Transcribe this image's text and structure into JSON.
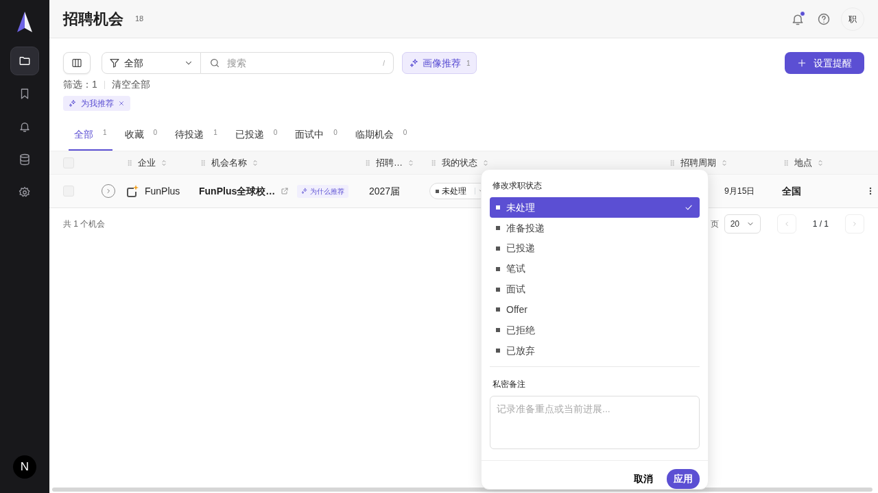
{
  "sidebar": {
    "items": [
      {
        "kind": "folder",
        "selected": true
      },
      {
        "kind": "bookmark",
        "selected": false
      },
      {
        "kind": "bell",
        "selected": false
      },
      {
        "kind": "database",
        "selected": false
      },
      {
        "kind": "gear",
        "selected": false
      }
    ],
    "user_avatar": "N"
  },
  "header": {
    "title": "招聘机会",
    "count": "18",
    "notification_unread": true,
    "avatar": "职"
  },
  "toolbar": {
    "filter": {
      "value": "全部"
    },
    "search": {
      "placeholder": "搜索",
      "shortcut": "/"
    },
    "profile_button": {
      "label": "画像推荐",
      "count": "1"
    },
    "primary_button": {
      "label": "设置提醒"
    }
  },
  "filter_summary": {
    "count_label": "筛选：1",
    "clear": "清空全部"
  },
  "chips": [
    {
      "label": "为我推荐"
    }
  ],
  "tabs": [
    {
      "label": "全部",
      "count": "1",
      "selected": true
    },
    {
      "label": "收藏",
      "count": "0",
      "selected": false
    },
    {
      "label": "待投递",
      "count": "1",
      "selected": false
    },
    {
      "label": "已投递",
      "count": "0",
      "selected": false
    },
    {
      "label": "面试中",
      "count": "0",
      "selected": false
    },
    {
      "label": "临期机会",
      "count": "0",
      "selected": false
    }
  ],
  "table": {
    "all_selected": false,
    "columns": [
      {
        "kind": "label",
        "label": "企业"
      },
      {
        "kind": "label",
        "label": "机会名称"
      },
      {
        "kind": "label",
        "label": "招聘…"
      },
      {
        "kind": "label",
        "label": "我的状态"
      },
      {
        "kind": "covered"
      },
      {
        "kind": "covered"
      },
      {
        "kind": "label",
        "label": "招聘周期"
      },
      {
        "kind": "label",
        "label": "地点"
      }
    ],
    "rows": [
      {
        "selected": false,
        "company": "FunPlus",
        "name": "FunPlus全球校…",
        "tag": "为什么推荐",
        "batch": "2027届",
        "status": "未处理",
        "cycle": "9月15日",
        "location": "全国"
      }
    ]
  },
  "footer": {
    "total": "共 1 个机会",
    "page_size_label": "页",
    "page_size": "20",
    "page": "1 / 1"
  },
  "status_popup": {
    "title": "修改求职状态",
    "options": [
      {
        "label": "未处理",
        "selected": true
      },
      {
        "label": "准备投递",
        "selected": false
      },
      {
        "label": "已投递",
        "selected": false
      },
      {
        "label": "笔试",
        "selected": false
      },
      {
        "label": "面试",
        "selected": false
      },
      {
        "label": "Offer",
        "selected": false
      },
      {
        "label": "已拒绝",
        "selected": false
      },
      {
        "label": "已放弃",
        "selected": false
      }
    ],
    "note_label": "私密备注",
    "note_placeholder": "记录准备重点或当前进展...",
    "cancel": "取消",
    "apply": "应用"
  }
}
